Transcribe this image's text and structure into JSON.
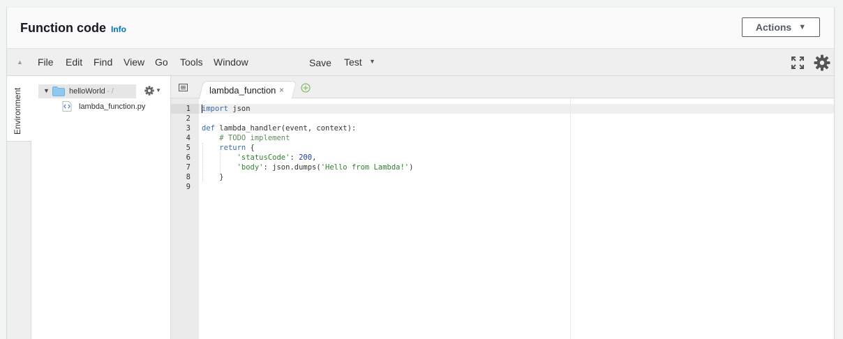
{
  "header": {
    "title": "Function code",
    "info_link": "Info",
    "actions_label": "Actions"
  },
  "menubar": {
    "items": [
      "File",
      "Edit",
      "Find",
      "View",
      "Go",
      "Tools",
      "Window"
    ],
    "save_label": "Save",
    "test_label": "Test"
  },
  "sidebar": {
    "environment_label": "Environment",
    "root_folder": "helloWorld",
    "root_path": "- /",
    "file_name": "lambda_function.py"
  },
  "editor": {
    "active_tab": "lambda_function",
    "tab_close": "×",
    "line_numbers": [
      "1",
      "2",
      "3",
      "4",
      "5",
      "6",
      "7",
      "8",
      "9"
    ],
    "code": {
      "l1_kw": "import",
      "l1_rest": " json",
      "l3_kw": "def",
      "l3_rest": " lambda_handler(event, context):",
      "l4_comment": "    # TODO implement",
      "l5_kw": "return",
      "l5_rest": " {",
      "l6_str": "'statusCode'",
      "l6_colon": ": ",
      "l6_num": "200",
      "l6_end": ",",
      "l7_str": "'body'",
      "l7_mid": ": json.dumps(",
      "l7_arg": "'Hello from Lambda!'",
      "l7_end": ")",
      "l8": "    }"
    }
  },
  "colors": {
    "accent_link": "#0073bb",
    "folder": "#8ec9f0",
    "keyword": "#3a6cae",
    "string": "#2f7f2f",
    "number": "#1a3bad"
  },
  "icons": [
    "collapse-arrow-icon",
    "fullscreen-icon",
    "gear-icon",
    "folder-icon",
    "python-file-icon",
    "tab-list-icon",
    "add-tab-icon"
  ]
}
